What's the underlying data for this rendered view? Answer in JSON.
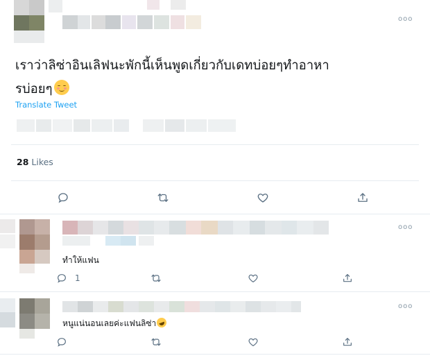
{
  "main_tweet": {
    "text_line1": "เราว่าลิซ่าอินเลิฟนะพักนี้เห็นพูดเกี่ยวกับเดทบ่อยๆทำอาหา",
    "text_line2": "รบ่อยๆ",
    "emoji": "☺",
    "translate_label": "Translate Tweet",
    "likes_count": "28",
    "likes_label": "Likes",
    "more_label": "ooo"
  },
  "replies": [
    {
      "text": "ทำให้แฟน",
      "reply_count": "1",
      "more_label": "ooo"
    },
    {
      "text": "หนูแน่นอนเลยค่ะแฟนลิซ่า",
      "emoji": "🤣",
      "more_label": "ooo"
    }
  ],
  "colors": {
    "link": "#1da1f2",
    "icon": "#5b7083",
    "divider": "#e6ecf0",
    "reply_bg": "#ffffff"
  }
}
